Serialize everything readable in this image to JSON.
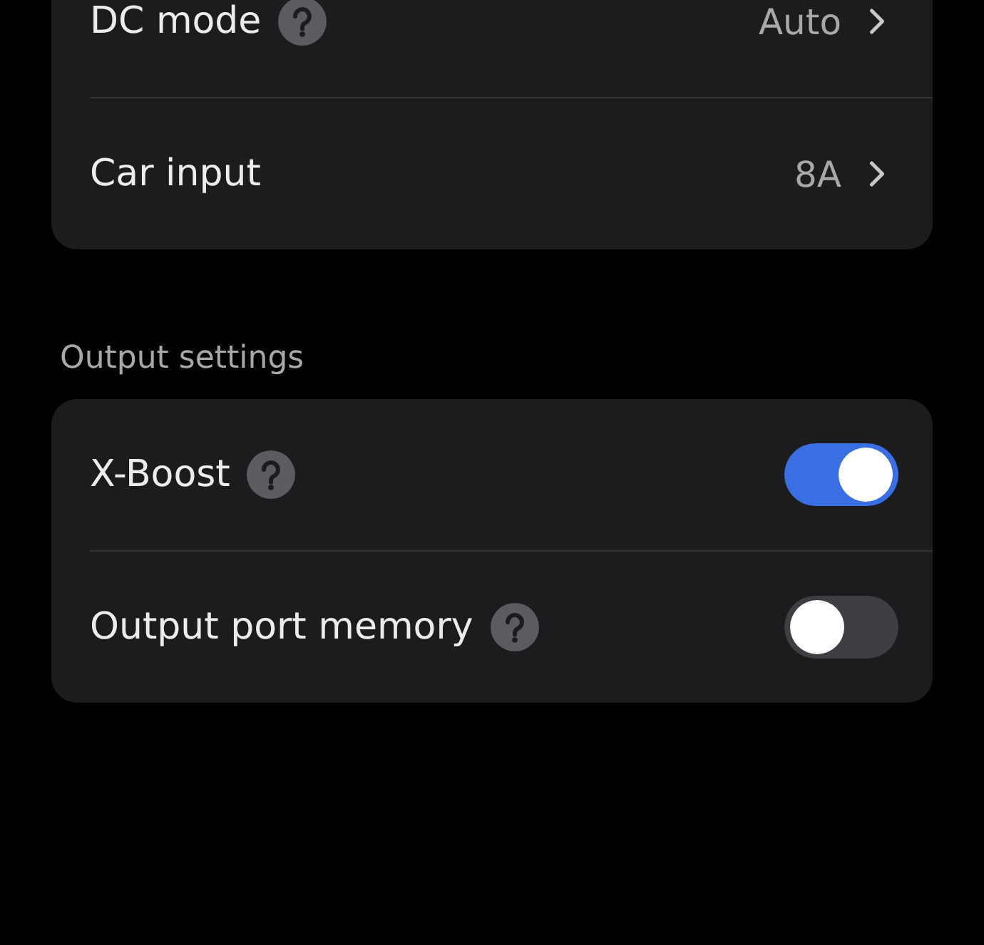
{
  "sections": [
    {
      "rows": [
        {
          "kind": "link",
          "label": "DC mode",
          "help": true,
          "value": "Auto"
        },
        {
          "kind": "link",
          "label": "Car input",
          "help": false,
          "value": "8A"
        }
      ]
    },
    {
      "title": "Output settings",
      "rows": [
        {
          "kind": "toggle",
          "label": "X-Boost",
          "help": true,
          "on": true
        },
        {
          "kind": "toggle",
          "label": "Output port memory",
          "help": true,
          "on": false
        }
      ]
    }
  ]
}
